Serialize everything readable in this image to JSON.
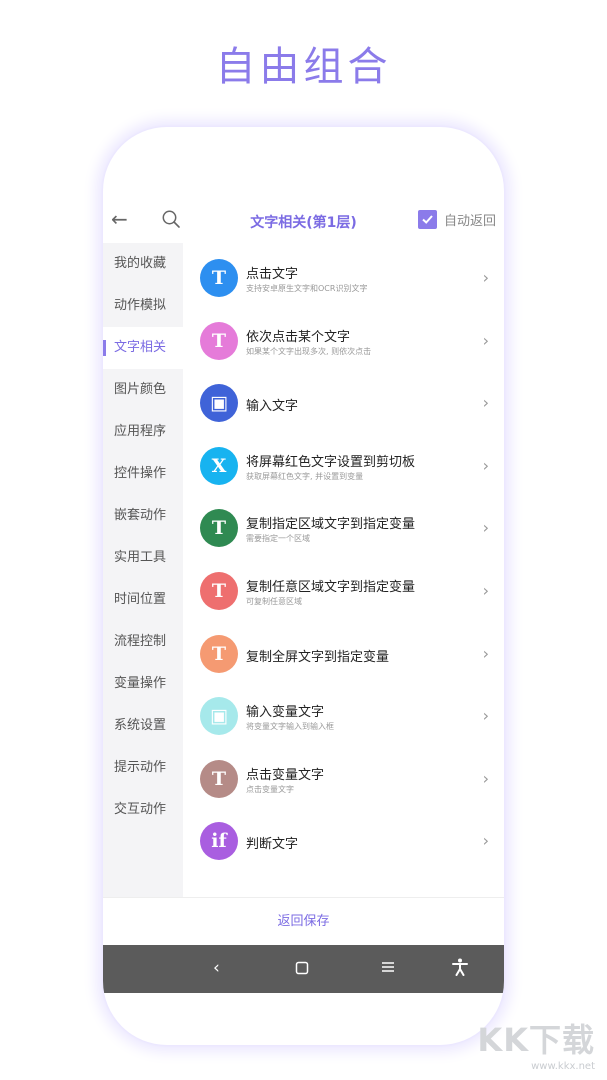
{
  "headline": "自由组合",
  "header": {
    "title": "文字相关(第1层)",
    "auto_return_label": "自动返回",
    "auto_return_checked": true
  },
  "sidebar": {
    "items": [
      {
        "label": "我的收藏"
      },
      {
        "label": "动作模拟"
      },
      {
        "label": "文字相关",
        "active": true
      },
      {
        "label": "图片颜色"
      },
      {
        "label": "应用程序"
      },
      {
        "label": "控件操作"
      },
      {
        "label": "嵌套动作"
      },
      {
        "label": "实用工具"
      },
      {
        "label": "时间位置"
      },
      {
        "label": "流程控制"
      },
      {
        "label": "变量操作"
      },
      {
        "label": "系统设置"
      },
      {
        "label": "提示动作"
      },
      {
        "label": "交互动作"
      }
    ]
  },
  "actions": [
    {
      "name": "点击文字",
      "desc": "支持安卓原生文字和OCR识别文字",
      "icon": "text-tap-icon",
      "glyph": "T",
      "color": "#2d8ff0"
    },
    {
      "name": "依次点击某个文字",
      "desc": "如果某个文字出现多次, 则依次点击",
      "icon": "text-sequence-icon",
      "glyph": "T",
      "color": "#e57bd9"
    },
    {
      "name": "输入文字",
      "desc": "",
      "icon": "input-box-icon",
      "glyph": "▣",
      "color": "#3f63d8"
    },
    {
      "name": "将屏幕红色文字设置到剪切板",
      "desc": "获取屏幕红色文字, 并设置到变量",
      "icon": "x-set-icon",
      "glyph": "X",
      "color": "#17b3f0"
    },
    {
      "name": "复制指定区域文字到指定变量",
      "desc": "需要指定一个区域",
      "icon": "copy-region-icon",
      "glyph": "T",
      "color": "#2f8a52"
    },
    {
      "name": "复制任意区域文字到指定变量",
      "desc": "可复制任意区域",
      "icon": "copy-any-icon",
      "glyph": "T",
      "color": "#ee6f6f"
    },
    {
      "name": "复制全屏文字到指定变量",
      "desc": "",
      "icon": "copy-fullscreen-icon",
      "glyph": "T",
      "color": "#f59a72"
    },
    {
      "name": "输入变量文字",
      "desc": "将变量文字输入到输入框",
      "icon": "input-variable-icon",
      "glyph": "▣",
      "color": "#a6e9eb"
    },
    {
      "name": "点击变量文字",
      "desc": "点击变量文字",
      "icon": "tap-variable-icon",
      "glyph": "T",
      "color": "#b58b87"
    },
    {
      "name": "判断文字",
      "desc": "",
      "icon": "if-text-icon",
      "glyph": "if",
      "color": "#a95ee0"
    }
  ],
  "footer": {
    "save_label": "返回保存"
  },
  "watermark": {
    "brand": "KK下载",
    "url": "www.kkx.net"
  }
}
